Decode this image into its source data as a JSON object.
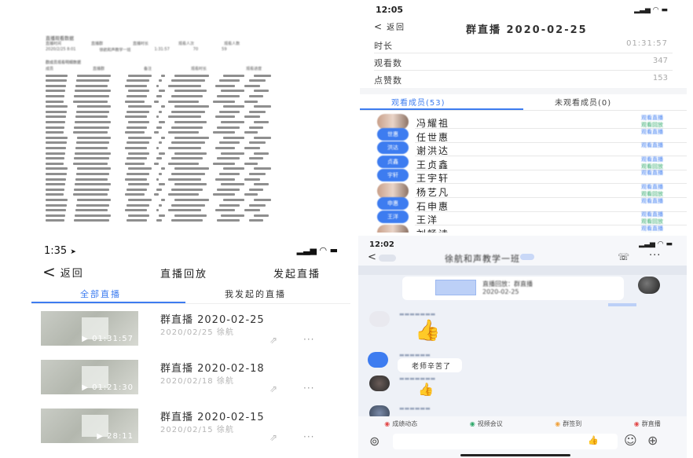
{
  "document": {
    "title": "直播观看数据",
    "header_labels": [
      "直播时间",
      "直播群",
      "直播时长",
      "观看人次",
      "观看人数"
    ],
    "summary_values": [
      "2020/2/25 8:01",
      "徐航和声教学一班",
      "1:31:57",
      "70",
      "59"
    ],
    "list_title": "群成员观看明细数据",
    "list_headers": [
      "成员",
      "直播群",
      "备注",
      "观看时长",
      "观看进度"
    ],
    "row_count": 29
  },
  "stats": {
    "status_time": "12:05",
    "back_label": "返回",
    "title": "群直播 2020-02-25",
    "rows": [
      {
        "label": "时长",
        "value": "01:31:57"
      },
      {
        "label": "观看数",
        "value": "347"
      },
      {
        "label": "点赞数",
        "value": "153"
      }
    ],
    "tab_watched": "观看成员(53)",
    "tab_unwatched": "未观看成员(0)",
    "members": [
      {
        "name": "冯耀祖",
        "avatar": "photo",
        "tag": "观看直播",
        "tag2": "观看回放"
      },
      {
        "name": "任世惠",
        "avatar": "世惠",
        "tag": "观看直播",
        "tag2": ""
      },
      {
        "name": "谢洪达",
        "avatar": "洪达",
        "tag": "观看直播",
        "tag2": ""
      },
      {
        "name": "王贞鑫",
        "avatar": "贞鑫",
        "tag": "观看直播",
        "tag2": "观看回放"
      },
      {
        "name": "王宇轩",
        "avatar": "宇轩",
        "tag": "观看直播",
        "tag2": ""
      },
      {
        "name": "杨艺凡",
        "avatar": "photo",
        "tag": "观看直播",
        "tag2": "观看回放"
      },
      {
        "name": "石申惠",
        "avatar": "申惠",
        "tag": "观看直播",
        "tag2": ""
      },
      {
        "name": "王洋",
        "avatar": "王洋",
        "tag": "观看直播",
        "tag2": "观看回放"
      },
      {
        "name": "刘畅诗",
        "avatar": "photo",
        "tag": "观看直播",
        "tag2": "观看回放"
      }
    ]
  },
  "replay": {
    "status_time": "1:35",
    "back_label": "返回",
    "title": "直播回放",
    "start_label": "发起直播",
    "tab_all": "全部直播",
    "tab_mine": "我发起的直播",
    "items": [
      {
        "title": "群直播 2020-02-25",
        "meta": "2020/02/25  徐航",
        "duration": "01:31:57"
      },
      {
        "title": "群直播 2020-02-18",
        "meta": "2020/02/18  徐航",
        "duration": "01:21:30"
      },
      {
        "title": "群直播 2020-02-15",
        "meta": "2020/02/15  徐航",
        "duration": "28:11"
      }
    ],
    "share_icon": "share-icon",
    "more_label": "···"
  },
  "chat": {
    "status_time": "12:02",
    "title": "徐航和声教学一班",
    "card_line1": "直播回放：群直播",
    "card_line2": "2020-02-25",
    "msg_text": "老师辛苦了",
    "toolbar": [
      "成绩动态",
      "视频会议",
      "群签到",
      "群直播"
    ],
    "accent": "#3d7cf0"
  }
}
